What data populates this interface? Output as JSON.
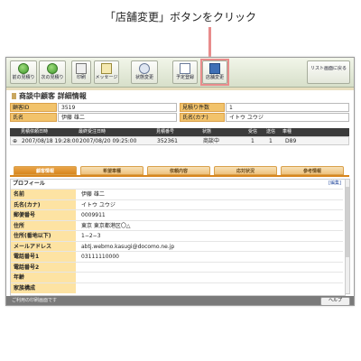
{
  "annotation": "「店舗変更」ボタンをクリック",
  "toolbar": {
    "buttons": [
      {
        "label": "前の見積り",
        "icon": "left-arrow-icon"
      },
      {
        "label": "次の見積り",
        "icon": "right-arrow-icon"
      },
      {
        "label": "印刷",
        "icon": "printer-icon"
      },
      {
        "label": "メッセージ",
        "icon": "envelope-icon"
      },
      {
        "label": "状態変更",
        "icon": "status-icon"
      },
      {
        "label": "予定登録",
        "icon": "calendar-icon"
      },
      {
        "label": "店舗変更",
        "icon": "store-change-icon"
      },
      {
        "label": "リスト画面に戻る",
        "icon": ""
      }
    ]
  },
  "page_title": "商談中顧客 詳細情報",
  "info": {
    "customer_id_label": "顧客ID",
    "customer_id": "3519",
    "name_label": "氏名",
    "name": "伊藤 雄二",
    "count_label": "見積り件数",
    "count": "1",
    "kana_label": "氏名(カナ)",
    "kana": "イトウ ユウジ"
  },
  "history": {
    "headers": [
      "見積依頼日時",
      "最終受注日時",
      "見積番号",
      "状態",
      "受信",
      "送信",
      "車種"
    ],
    "row": [
      "2007/08/18 19:28:00",
      "2007/08/20 09:25:00",
      "352361",
      "商談中",
      "1",
      "1",
      "D89"
    ]
  },
  "tabs": [
    "顧客情報",
    "希望車種",
    "依頼内容",
    "応対状況",
    "参考情報"
  ],
  "profile": {
    "title": "プロフィール",
    "edit_link": "[編集]",
    "rows": [
      {
        "label": "名前",
        "value": "伊藤 雄二"
      },
      {
        "label": "氏名(カナ)",
        "value": "イトウ ユウジ"
      },
      {
        "label": "郵便番号",
        "value": "0009911"
      },
      {
        "label": "住所",
        "value": "東京 東京都港区〇△"
      },
      {
        "label": "住所(番地以下)",
        "value": "1−2−3"
      },
      {
        "label": "メールアドレス",
        "value": "abtj.webmo.kasugi@docomo.ne.jp"
      },
      {
        "label": "電話番号1",
        "value": "03111110000"
      },
      {
        "label": "電話番号2",
        "value": ""
      },
      {
        "label": "年齢",
        "value": ""
      },
      {
        "label": "家族構成",
        "value": ""
      }
    ]
  },
  "status_bar": {
    "text": "ご利用の印刷画面です",
    "help_label": "ヘルプ"
  },
  "colors": {
    "accent": "#d8861e",
    "label_bg": "#fde3a3",
    "header_dark": "#3b3b3b",
    "highlight": "#e88c8c"
  }
}
